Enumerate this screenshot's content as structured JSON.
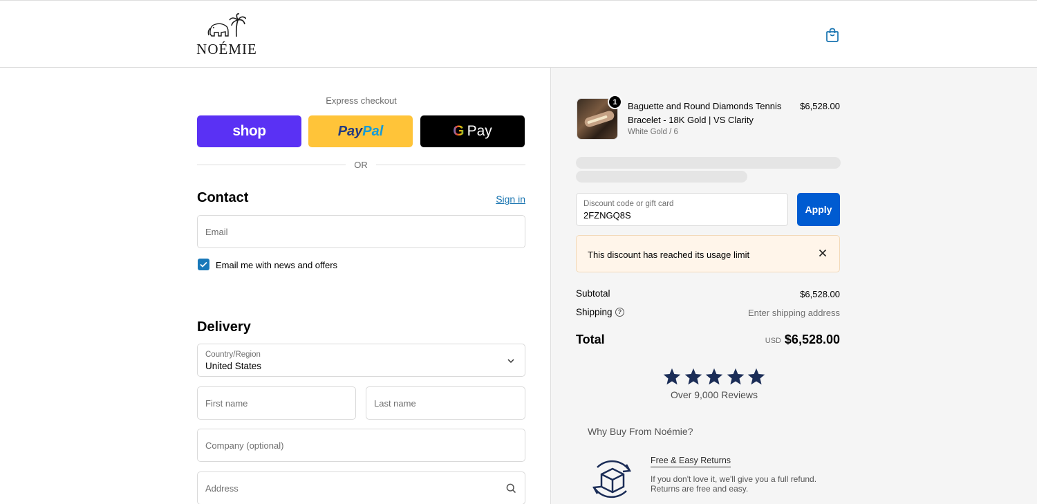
{
  "header": {
    "logo_text": "NOÉMIE",
    "bag_icon": "shopping-bag-icon"
  },
  "express": {
    "label": "Express checkout",
    "shop_label": "shop",
    "paypal_part1": "Pay",
    "paypal_part2": "Pal",
    "gpay_g": "G",
    "gpay_label": "Pay",
    "or_label": "OR"
  },
  "contact": {
    "title": "Contact",
    "sign_in": "Sign in",
    "email_placeholder": "Email",
    "newsletter_label": "Email me with news and offers",
    "newsletter_checked": true
  },
  "delivery": {
    "title": "Delivery",
    "country_label": "Country/Region",
    "country_value": "United States",
    "first_name_placeholder": "First name",
    "last_name_placeholder": "Last name",
    "company_placeholder": "Company (optional)",
    "address_placeholder": "Address"
  },
  "order": {
    "item": {
      "quantity": "1",
      "name": "Baguette and Round Diamonds Tennis Bracelet - 18K Gold | VS Clarity",
      "variant": "White Gold / 6",
      "price": "$6,528.00"
    },
    "discount": {
      "label": "Discount code or gift card",
      "value": "2FZNGQ8S",
      "apply_label": "Apply",
      "alert": "This discount has reached its usage limit"
    },
    "subtotal_label": "Subtotal",
    "subtotal_value": "$6,528.00",
    "shipping_label": "Shipping",
    "shipping_value": "Enter shipping address",
    "total_label": "Total",
    "currency": "USD",
    "total_value": "$6,528.00"
  },
  "reviews": {
    "star_count": 5,
    "text": "Over 9,000 Reviews"
  },
  "why": {
    "title": "Why Buy From Noémie?",
    "returns_title": "Free & Easy Returns",
    "returns_desc": "If you don't love it, we'll give you a full refund. Returns are free and easy."
  },
  "colors": {
    "shop_purple": "#5a31f4",
    "paypal_yellow": "#ffc439",
    "apply_blue": "#005bd1",
    "link_blue": "#1773b0",
    "star_navy": "#1b2d57"
  }
}
